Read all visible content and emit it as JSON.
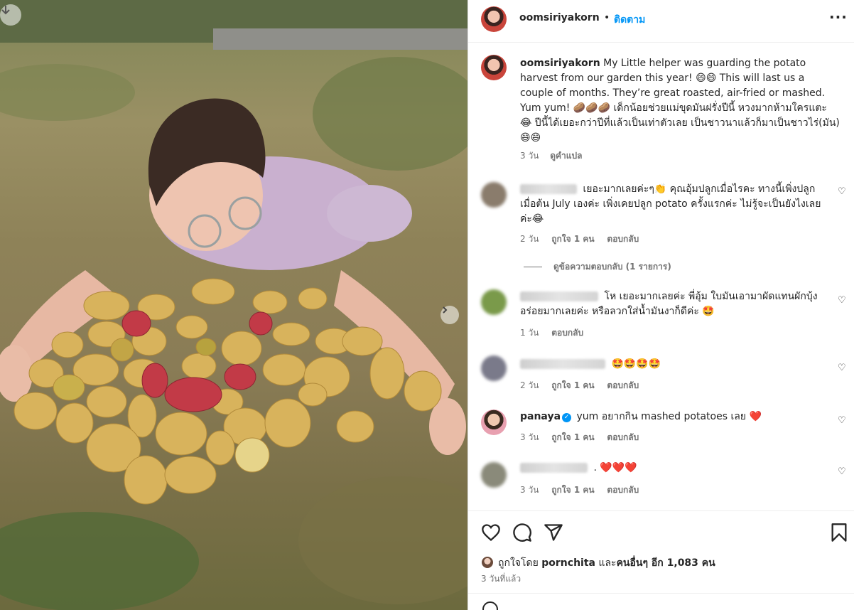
{
  "post": {
    "username": "oomsiriyakorn",
    "dot": "•",
    "follow_label": "ติดตาม",
    "more_icon": "more-horizontal-icon",
    "caption_username": "oomsiriyakorn",
    "caption_text": "My Little helper was guarding the potato harvest from our garden this year! 😄😄 This will last us a couple of months. They’re great roasted, air-fried or mashed. Yum yum! 🥔🥔🥔 เด็กน้อยช่วยแม่ขุดมันฝรั่งปีนี้ หวงมากห้ามใครแตะ 😂 ปีนี้ได้เยอะกว่าปีที่แล้วเป็นเท่าตัวเลย เป็นชาวนาแล้วก็มาเป็นชาวไร่(มัน) 😄😄",
    "caption_age": "3 วัน",
    "see_translation": "ดูคำแปล"
  },
  "comments": [
    {
      "text": "เยอะมากเลยค่ะๆ👏 คุณอุ้มปลูกเมื่อไรคะ ทางนี้เพิ่งปลูกเมื่อต้น July เองค่ะ เพิ่งเคยปลูก potato ครั้งแรกค่ะ ไม่รู้จะเป็นยังไงเลยค่ะ😂",
      "age": "2 วัน",
      "likes": "ถูกใจ 1 คน",
      "reply": "ตอบกลับ"
    },
    {
      "text": "โห เยอะมากเลยค่ะ พี่อุ้ม ใบมันเอามาผัดแทนผักบุ้ง อร่อยมากเลยค่ะ หรือลวกใส่น้ำมันงาก็ดีค่ะ 🤩",
      "age": "1 วัน",
      "reply": "ตอบกลับ"
    },
    {
      "text": "🤩🤩🤩🤩",
      "age": "2 วัน",
      "likes": "ถูกใจ 1 คน",
      "reply": "ตอบกลับ"
    },
    {
      "username": "panaya",
      "verified_icon": "verified-badge-icon",
      "text": "yum อยากกิน mashed potatoes เลย ❤️",
      "age": "3 วัน",
      "likes": "ถูกใจ 1 คน",
      "reply": "ตอบกลับ"
    },
    {
      "text": ". ❤️❤️❤️",
      "age": "3 วัน",
      "likes": "ถูกใจ 1 คน",
      "reply": "ตอบกลับ"
    }
  ],
  "view_replies": "ดูข้อความตอบกลับ (1 รายการ)",
  "actions": {
    "like_icon": "heart-icon",
    "comment_icon": "comment-icon",
    "share_icon": "share-icon",
    "save_icon": "bookmark-icon"
  },
  "likes": {
    "prefix": "ถูกใจโดย",
    "user": "pornchita",
    "and": "และ",
    "others": "คนอื่นๆ อีก 1,083 คน"
  },
  "posted_ago": "3 วันที่แล้ว",
  "colors": {
    "link": "#0095f6",
    "text": "#262626",
    "muted": "#737373",
    "heart": "#ed4956"
  }
}
